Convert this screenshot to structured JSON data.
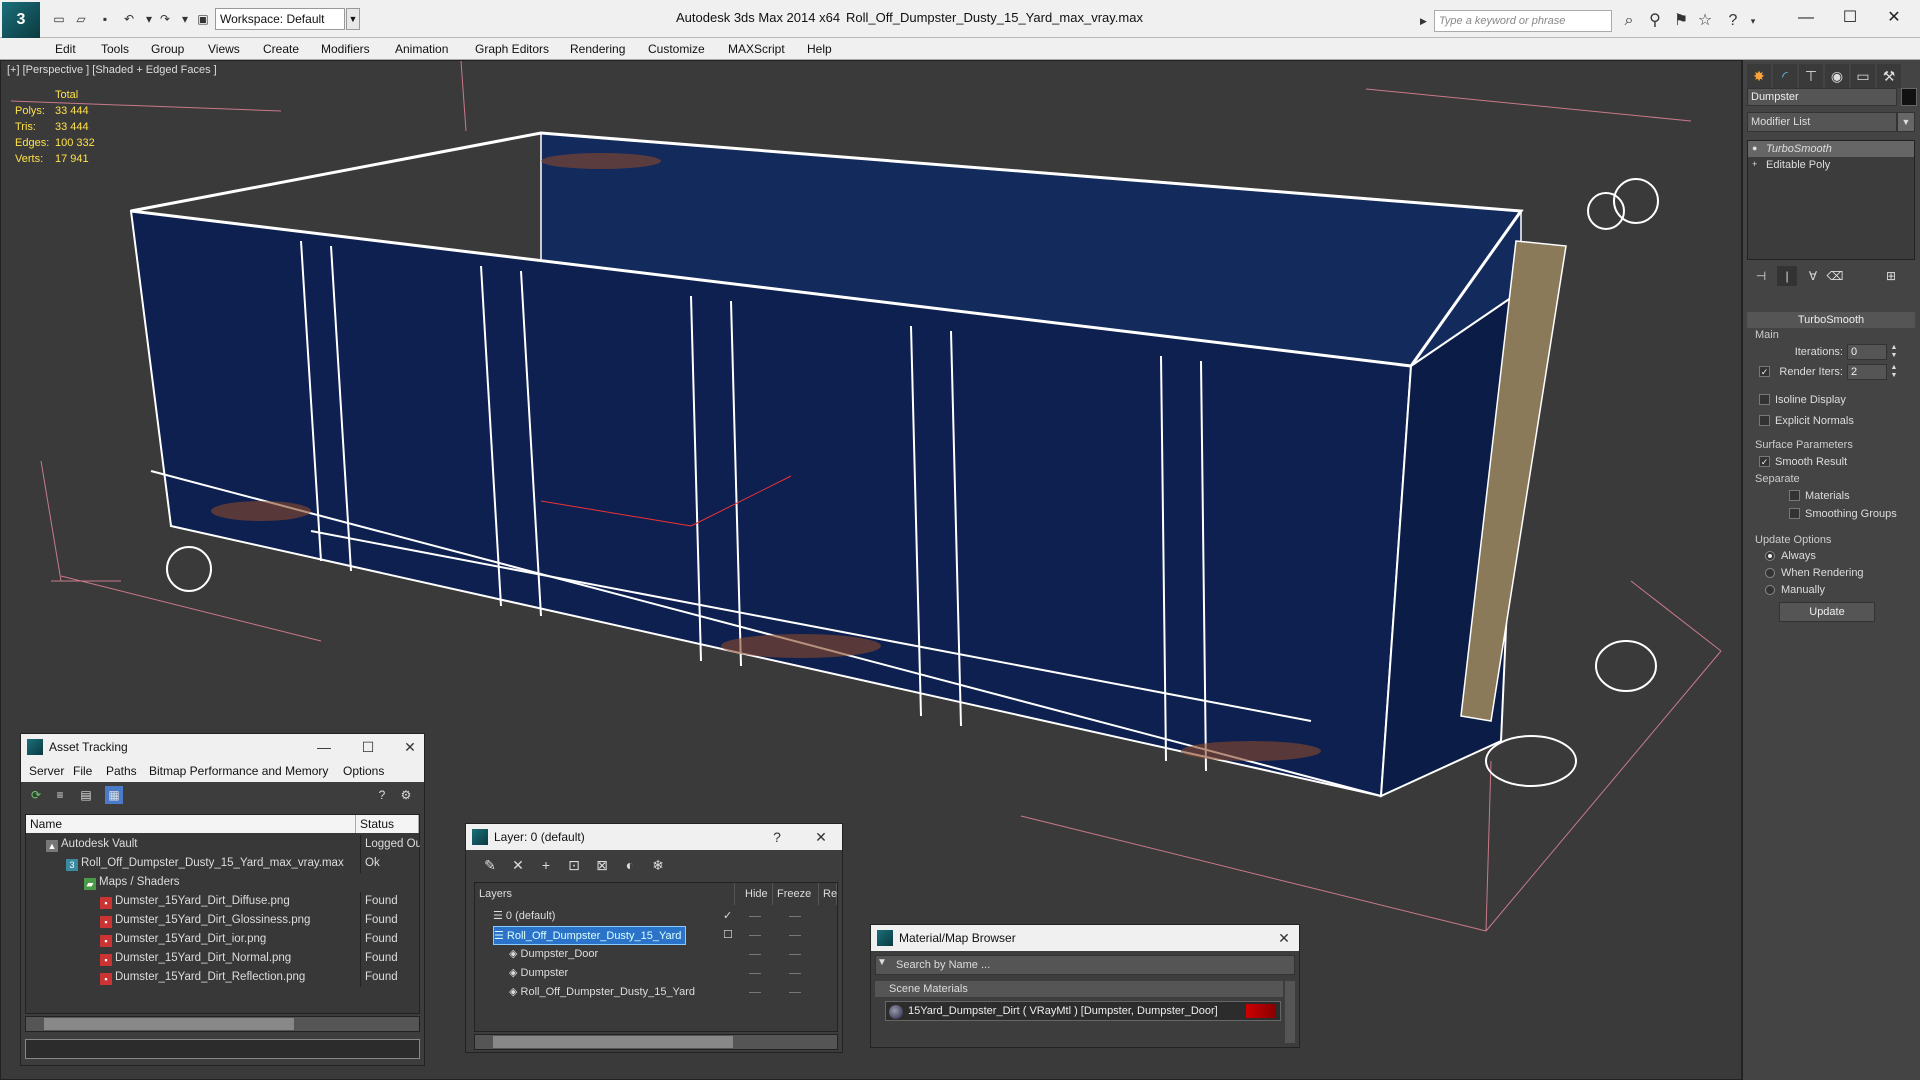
{
  "titlebar": {
    "workspace": "Workspace: Default",
    "app_name": "Autodesk 3ds Max  2014 x64",
    "file_name": "Roll_Off_Dumpster_Dusty_15_Yard_max_vray.max",
    "search_placeholder": "Type a keyword or phrase",
    "minimize_glyph": "—",
    "maximize_glyph": "☐",
    "close_glyph": "✕"
  },
  "menu": [
    "Edit",
    "Tools",
    "Group",
    "Views",
    "Create",
    "Modifiers",
    "Animation",
    "Graph Editors",
    "Rendering",
    "Customize",
    "MAXScript",
    "Help"
  ],
  "viewport": {
    "label": "[+] [Perspective ] [Shaded + Edged Faces ]",
    "stats": {
      "header": "Total",
      "rows": [
        {
          "label": "Polys:",
          "value": "33 444"
        },
        {
          "label": "Tris:",
          "value": "33 444"
        },
        {
          "label": "Edges:",
          "value": "100 332"
        },
        {
          "label": "Verts:",
          "value": "17 941"
        }
      ]
    }
  },
  "command_panel": {
    "object_name": "Dumpster",
    "modifier_list": "Modifier List",
    "stack": [
      {
        "label": "TurboSmooth",
        "selected": true
      },
      {
        "label": "Editable Poly",
        "selected": false
      }
    ],
    "rollout_title": "TurboSmooth",
    "main_group": "Main",
    "iterations_label": "Iterations:",
    "iterations_value": "0",
    "render_iters_label": "Render Iters:",
    "render_iters_value": "2",
    "isoline_label": "Isoline Display",
    "explicit_normals_label": "Explicit Normals",
    "surface_group": "Surface Parameters",
    "smooth_result_label": "Smooth Result",
    "separate_label": "Separate",
    "materials_label": "Materials",
    "smoothing_groups_label": "Smoothing Groups",
    "update_group": "Update Options",
    "always_label": "Always",
    "when_rendering_label": "When Rendering",
    "manually_label": "Manually",
    "update_button": "Update"
  },
  "asset_tracking": {
    "title": "Asset Tracking",
    "menu": [
      "Server",
      "File",
      "Paths",
      "Bitmap Performance and Memory",
      "Options"
    ],
    "columns": {
      "name": "Name",
      "status": "Status"
    },
    "rows": [
      {
        "name": "Autodesk Vault",
        "status": "Logged Out",
        "icon": "vault-icon"
      },
      {
        "name": "Roll_Off_Dumpster_Dusty_15_Yard_max_vray.max",
        "status": "Ok",
        "icon": "max-file-icon"
      },
      {
        "name": "Maps / Shaders",
        "status": "",
        "icon": "folder-icon"
      },
      {
        "name": "Dumster_15Yard_Dirt_Diffuse.png",
        "status": "Found",
        "icon": "png-icon"
      },
      {
        "name": "Dumster_15Yard_Dirt_Glossiness.png",
        "status": "Found",
        "icon": "png-icon"
      },
      {
        "name": "Dumster_15Yard_Dirt_ior.png",
        "status": "Found",
        "icon": "png-icon"
      },
      {
        "name": "Dumster_15Yard_Dirt_Normal.png",
        "status": "Found",
        "icon": "png-icon"
      },
      {
        "name": "Dumster_15Yard_Dirt_Reflection.png",
        "status": "Found",
        "icon": "png-icon"
      }
    ]
  },
  "layer_window": {
    "title": "Layer: 0 (default)",
    "help_glyph": "?",
    "columns": {
      "layers": "Layers",
      "hide": "Hide",
      "freeze": "Freeze",
      "render": "Re"
    },
    "rows": [
      {
        "name": "0 (default)",
        "selected": false,
        "check": "✓"
      },
      {
        "name": "Roll_Off_Dumpster_Dusty_15_Yard",
        "selected": true,
        "check": "☐"
      },
      {
        "name": "Dumpster_Door",
        "selected": false,
        "check": ""
      },
      {
        "name": "Dumpster",
        "selected": false,
        "check": ""
      },
      {
        "name": "Roll_Off_Dumpster_Dusty_15_Yard",
        "selected": false,
        "check": ""
      }
    ]
  },
  "material_browser": {
    "title": "Material/Map Browser",
    "search_placeholder": "Search by Name ...",
    "section": "Scene Materials",
    "item": "15Yard_Dumpster_Dirt  ( VRayMtl ) [Dumpster, Dumpster_Door]"
  }
}
